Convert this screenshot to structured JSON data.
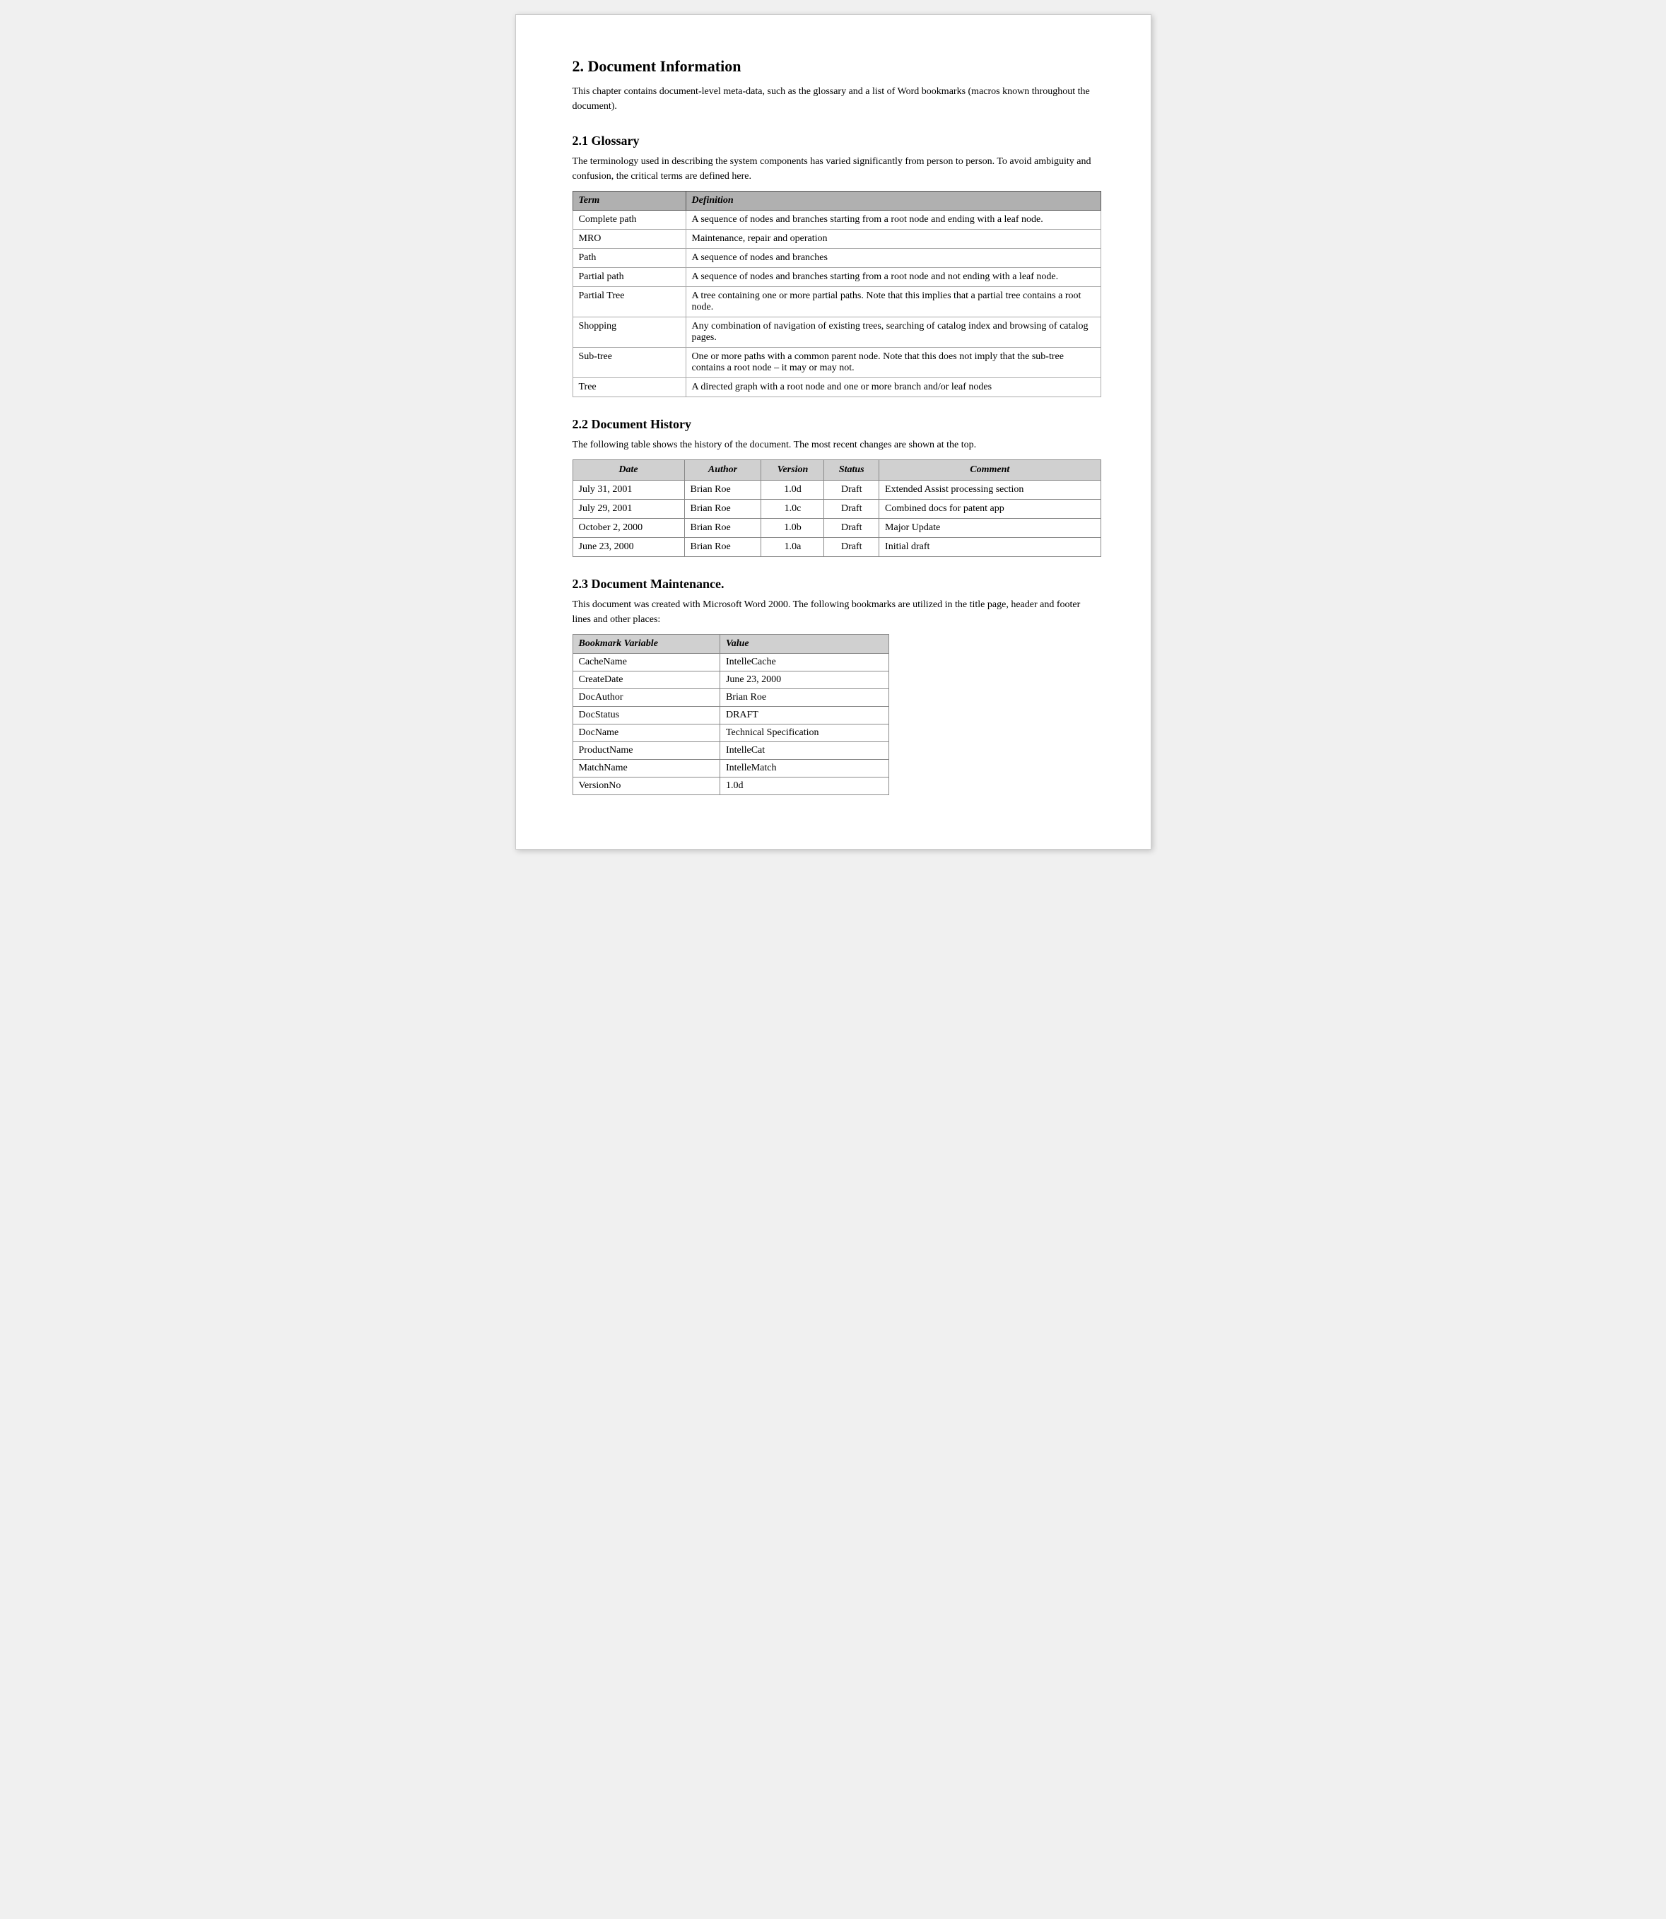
{
  "page": {
    "section2": {
      "heading": "2.   Document Information",
      "intro": "This chapter contains document-level meta-data, such as the glossary and a list of Word bookmarks (macros known throughout the document)."
    },
    "section2_1": {
      "heading": "2.1  Glossary",
      "intro": "The terminology used in describing the system components has varied significantly from person to person.  To avoid ambiguity and confusion, the critical terms are defined here.",
      "table": {
        "headers": [
          "Term",
          "Definition"
        ],
        "rows": [
          [
            "Complete path",
            "A sequence of nodes and branches starting from a root node and ending with a leaf node."
          ],
          [
            "MRO",
            "Maintenance, repair and operation"
          ],
          [
            "Path",
            "A sequence of nodes and branches"
          ],
          [
            "Partial path",
            "A sequence of nodes and branches starting from a root node and not ending with a leaf node."
          ],
          [
            "Partial Tree",
            "A tree containing one or more partial paths.  Note that this implies that a partial tree contains a root node."
          ],
          [
            "Shopping",
            "Any combination of navigation of existing trees, searching of catalog index and browsing of catalog pages."
          ],
          [
            "Sub-tree",
            "One or more paths with a common parent node.  Note that this does not imply that the sub-tree contains a root node – it may or may not."
          ],
          [
            "Tree",
            "A directed graph with a root node and one or more branch and/or leaf nodes"
          ]
        ]
      }
    },
    "section2_2": {
      "heading": "2.2  Document History",
      "intro": "The following table shows the history of the document.  The most recent changes are shown at the top.",
      "table": {
        "headers": [
          "Date",
          "Author",
          "Version",
          "Status",
          "Comment"
        ],
        "rows": [
          [
            "July 31, 2001",
            "Brian Roe",
            "1.0d",
            "Draft",
            "Extended Assist processing section"
          ],
          [
            "July 29, 2001",
            "Brian Roe",
            "1.0c",
            "Draft",
            "Combined docs for patent app"
          ],
          [
            "October 2, 2000",
            "Brian Roe",
            "1.0b",
            "Draft",
            "Major Update"
          ],
          [
            "June 23, 2000",
            "Brian Roe",
            "1.0a",
            "Draft",
            "Initial draft"
          ]
        ]
      }
    },
    "section2_3": {
      "heading": "2.3  Document Maintenance.",
      "intro": "This document was created with Microsoft Word 2000. The following bookmarks are utilized in the title page, header and footer lines and other places:",
      "table": {
        "headers": [
          "Bookmark Variable",
          "Value"
        ],
        "rows": [
          [
            "CacheName",
            "IntelleCache"
          ],
          [
            "CreateDate",
            "June 23, 2000"
          ],
          [
            "DocAuthor",
            "Brian Roe"
          ],
          [
            "DocStatus",
            "DRAFT"
          ],
          [
            "DocName",
            "Technical Specification"
          ],
          [
            "ProductName",
            "IntelleCat"
          ],
          [
            "MatchName",
            "IntelleMatch"
          ],
          [
            "VersionNo",
            "1.0d"
          ]
        ]
      }
    }
  }
}
